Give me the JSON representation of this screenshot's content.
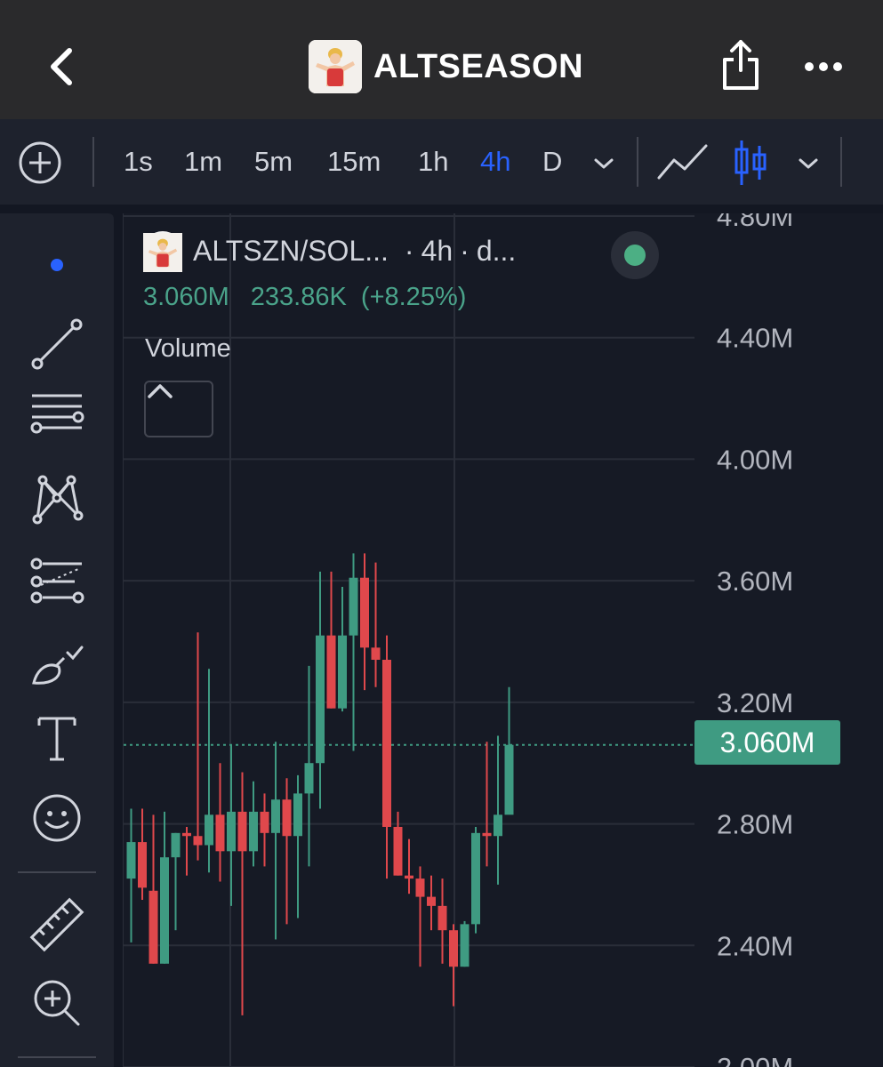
{
  "header": {
    "title": "ALTSEASON",
    "back_icon": "chevron-left-icon",
    "share_icon": "share-icon",
    "more_icon": "more-horizontal-icon"
  },
  "toolbar": {
    "timeframes": [
      "1s",
      "1m",
      "5m",
      "15m",
      "1h",
      "4h",
      "D"
    ],
    "active_timeframe": "4h",
    "chart_types": [
      "line-chart-icon",
      "candlestick-icon"
    ],
    "active_color": "#2962ff"
  },
  "sidebar": {
    "tools": [
      "crosshair-dot-icon",
      "trend-line-icon",
      "fib-retracement-icon",
      "pattern-icon",
      "prediction-icon",
      "brush-icon",
      "text-icon",
      "emoji-icon",
      "ruler-icon",
      "zoom-in-icon"
    ]
  },
  "legend": {
    "symbol": "ALTSZN/SOL...",
    "interval": "4h",
    "exchange": "d...",
    "separator": "·",
    "price": "3.060M",
    "change": "233.86K",
    "change_pct": "(+8.25%)",
    "status_color": "#4caf84",
    "volume_label": "Volume"
  },
  "price_axis": {
    "labels": [
      "4.80M",
      "4.40M",
      "4.00M",
      "3.60M",
      "3.20M",
      "2.80M",
      "2.40M",
      "2.00M"
    ],
    "current_price": "3.060M"
  },
  "colors": {
    "up": "#3f9b82",
    "down": "#e0484c",
    "background": "#161a25"
  },
  "chart_data": {
    "type": "candlestick",
    "ylim": [
      2.0,
      4.8
    ],
    "unit": "M",
    "current": 3.06,
    "candles": [
      {
        "o": 2.62,
        "h": 2.85,
        "l": 2.41,
        "c": 2.74
      },
      {
        "o": 2.74,
        "h": 2.85,
        "l": 2.55,
        "c": 2.59
      },
      {
        "o": 2.58,
        "h": 2.83,
        "l": 2.34,
        "c": 2.34
      },
      {
        "o": 2.34,
        "h": 2.84,
        "l": 2.34,
        "c": 2.69
      },
      {
        "o": 2.69,
        "h": 2.77,
        "l": 2.45,
        "c": 2.77
      },
      {
        "o": 2.77,
        "h": 2.79,
        "l": 2.63,
        "c": 2.76
      },
      {
        "o": 2.76,
        "h": 3.43,
        "l": 2.68,
        "c": 2.73
      },
      {
        "o": 2.73,
        "h": 3.31,
        "l": 2.64,
        "c": 2.83
      },
      {
        "o": 2.83,
        "h": 3.0,
        "l": 2.61,
        "c": 2.71
      },
      {
        "o": 2.71,
        "h": 3.06,
        "l": 2.53,
        "c": 2.84
      },
      {
        "o": 2.84,
        "h": 2.97,
        "l": 2.17,
        "c": 2.71
      },
      {
        "o": 2.71,
        "h": 2.94,
        "l": 2.66,
        "c": 2.84
      },
      {
        "o": 2.84,
        "h": 2.9,
        "l": 2.66,
        "c": 2.77
      },
      {
        "o": 2.77,
        "h": 3.07,
        "l": 2.42,
        "c": 2.88
      },
      {
        "o": 2.88,
        "h": 2.95,
        "l": 2.47,
        "c": 2.76
      },
      {
        "o": 2.76,
        "h": 2.96,
        "l": 2.49,
        "c": 2.9
      },
      {
        "o": 2.9,
        "h": 3.32,
        "l": 2.66,
        "c": 3.0
      },
      {
        "o": 3.0,
        "h": 3.63,
        "l": 2.85,
        "c": 3.42
      },
      {
        "o": 3.42,
        "h": 3.63,
        "l": 3.18,
        "c": 3.18
      },
      {
        "o": 3.18,
        "h": 3.58,
        "l": 3.17,
        "c": 3.42
      },
      {
        "o": 3.42,
        "h": 3.69,
        "l": 3.04,
        "c": 3.61
      },
      {
        "o": 3.61,
        "h": 3.69,
        "l": 3.24,
        "c": 3.38
      },
      {
        "o": 3.38,
        "h": 3.66,
        "l": 3.25,
        "c": 3.34
      },
      {
        "o": 3.34,
        "h": 3.42,
        "l": 2.62,
        "c": 2.79
      },
      {
        "o": 2.79,
        "h": 2.84,
        "l": 2.63,
        "c": 2.63
      },
      {
        "o": 2.63,
        "h": 2.75,
        "l": 2.57,
        "c": 2.62
      },
      {
        "o": 2.62,
        "h": 2.66,
        "l": 2.33,
        "c": 2.56
      },
      {
        "o": 2.56,
        "h": 2.63,
        "l": 2.45,
        "c": 2.53
      },
      {
        "o": 2.53,
        "h": 2.62,
        "l": 2.34,
        "c": 2.45
      },
      {
        "o": 2.45,
        "h": 2.47,
        "l": 2.2,
        "c": 2.33
      },
      {
        "o": 2.33,
        "h": 2.48,
        "l": 2.33,
        "c": 2.47
      },
      {
        "o": 2.47,
        "h": 2.79,
        "l": 2.44,
        "c": 2.77
      },
      {
        "o": 2.77,
        "h": 3.07,
        "l": 2.66,
        "c": 2.76
      },
      {
        "o": 2.76,
        "h": 3.09,
        "l": 2.6,
        "c": 2.83
      },
      {
        "o": 2.83,
        "h": 3.25,
        "l": 2.85,
        "c": 3.06
      }
    ]
  }
}
